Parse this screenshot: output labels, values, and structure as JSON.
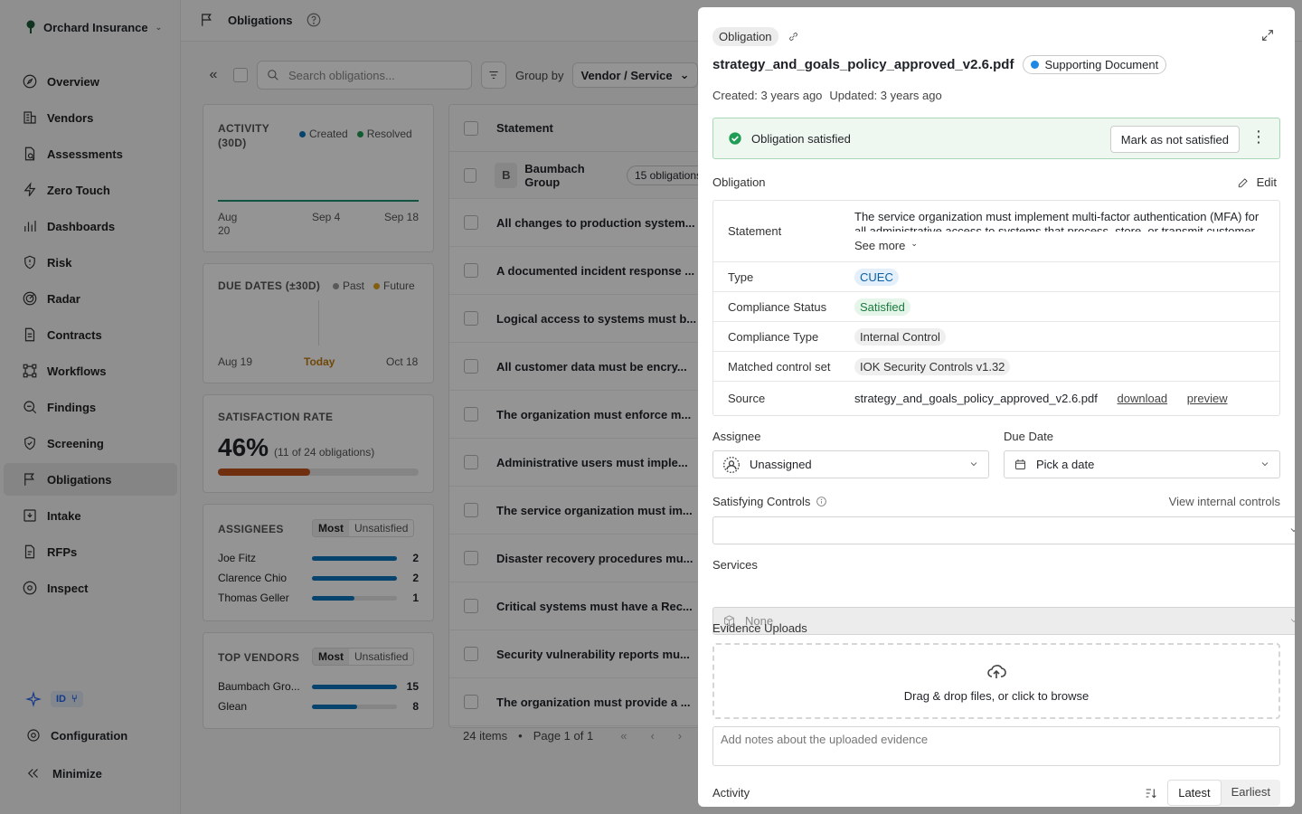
{
  "org": {
    "name": "Orchard Insurance"
  },
  "nav": [
    {
      "label": "Overview",
      "icon": "compass-icon"
    },
    {
      "label": "Vendors",
      "icon": "building-icon"
    },
    {
      "label": "Assessments",
      "icon": "document-search-icon"
    },
    {
      "label": "Zero Touch",
      "icon": "lightning-icon"
    },
    {
      "label": "Dashboards",
      "icon": "chart-icon"
    },
    {
      "label": "Risk",
      "icon": "shield-alert-icon"
    },
    {
      "label": "Radar",
      "icon": "radar-icon"
    },
    {
      "label": "Contracts",
      "icon": "contract-icon"
    },
    {
      "label": "Workflows",
      "icon": "workflow-icon"
    },
    {
      "label": "Findings",
      "icon": "findings-icon"
    },
    {
      "label": "Screening",
      "icon": "shield-check-icon"
    },
    {
      "label": "Obligations",
      "icon": "flag-icon",
      "active": true
    },
    {
      "label": "Intake",
      "icon": "intake-icon"
    },
    {
      "label": "RFPs",
      "icon": "rfp-icon"
    },
    {
      "label": "Inspect",
      "icon": "inspect-icon"
    }
  ],
  "sidebar_footer": {
    "id_label": "ID",
    "configuration": "Configuration",
    "minimize": "Minimize"
  },
  "topbar": {
    "title": "Obligations"
  },
  "toolbar": {
    "search_placeholder": "Search obligations...",
    "group_by_label": "Group by",
    "group_by_value": "Vendor / Service"
  },
  "activity_card": {
    "title": "ACTIVITY (30D)",
    "legend_created": "Created",
    "legend_resolved": "Resolved",
    "x_labels": [
      "Aug 20",
      "Sep 4",
      "Sep 18"
    ]
  },
  "due_card": {
    "title": "DUE DATES (±30D)",
    "legend_past": "Past",
    "legend_future": "Future",
    "x_labels": [
      "Aug 19",
      "Today",
      "Oct 18"
    ]
  },
  "satisfaction_card": {
    "title": "SATISFACTION RATE",
    "percent": "46%",
    "detail": "(11 of 24 obligations)",
    "fraction": 0.46
  },
  "assignees_card": {
    "title": "ASSIGNEES",
    "seg_most": "Most",
    "seg_unsat": "Unsatisfied",
    "rows": [
      {
        "name": "Joe Fitz",
        "count": "2",
        "fraction": 1.0
      },
      {
        "name": "Clarence Chio",
        "count": "2",
        "fraction": 1.0
      },
      {
        "name": "Thomas Geller",
        "count": "1",
        "fraction": 0.5
      }
    ]
  },
  "vendors_card": {
    "title": "TOP VENDORS",
    "seg_most": "Most",
    "seg_unsat": "Unsatisfied",
    "rows": [
      {
        "name": "Baumbach Gro...",
        "count": "15",
        "fraction": 1.0
      },
      {
        "name": "Glean",
        "count": "8",
        "fraction": 0.53
      }
    ]
  },
  "table": {
    "header_statement": "Statement",
    "group": {
      "initial": "B",
      "name": "Baumbach Group",
      "count": "15 obligations"
    },
    "rows": [
      "All changes to production system...",
      "A documented incident response ...",
      "Logical access to systems must b...",
      "All customer data must be encry...",
      "The organization must enforce m...",
      "Administrative users must imple...",
      "The service organization must im...",
      "Disaster recovery procedures mu...",
      "Critical systems must have a Rec...",
      "Security vulnerability reports mu...",
      "The organization must provide a ..."
    ],
    "pager": {
      "items": "24 items",
      "page": "Page 1 of 1"
    }
  },
  "drawer": {
    "tag": "Obligation",
    "file_name": "strategy_and_goals_policy_approved_v2.6.pdf",
    "doc_badge": "Supporting Document",
    "created": "Created: 3 years ago",
    "updated": "Updated: 3 years ago",
    "status_text": "Obligation satisfied",
    "mark_button": "Mark as not satisfied",
    "section_obligation": "Obligation",
    "edit": "Edit",
    "statement_label": "Statement",
    "statement_text": "The service organization must implement multi-factor authentication (MFA) for all administrative access to systems that process, store, or transmit customer",
    "see_more": "See more",
    "fields": {
      "type_label": "Type",
      "type_value": "CUEC",
      "compliance_status_label": "Compliance Status",
      "compliance_status_value": "Satisfied",
      "compliance_type_label": "Compliance Type",
      "compliance_type_value": "Internal Control",
      "matched_label": "Matched control set",
      "matched_value": "IOK Security Controls v1.32",
      "source_label": "Source",
      "source_value": "strategy_and_goals_policy_approved_v2.6.pdf",
      "download": "download",
      "preview": "preview"
    },
    "assignee_label": "Assignee",
    "assignee_value": "Unassigned",
    "due_label": "Due Date",
    "due_placeholder": "Pick a date",
    "controls_label": "Satisfying Controls",
    "view_internal": "View internal controls",
    "services_label": "Services",
    "services_value": "None",
    "evidence_label": "Evidence Uploads",
    "dropzone_text": "Drag & drop files, or click to browse",
    "notes_placeholder": "Add notes about the uploaded evidence",
    "activity_label": "Activity",
    "sort_latest": "Latest",
    "sort_earliest": "Earliest"
  },
  "colors": {
    "accent_blue": "#0b75be",
    "satisfied_green": "#1f9d55",
    "orange": "#c2541b"
  }
}
